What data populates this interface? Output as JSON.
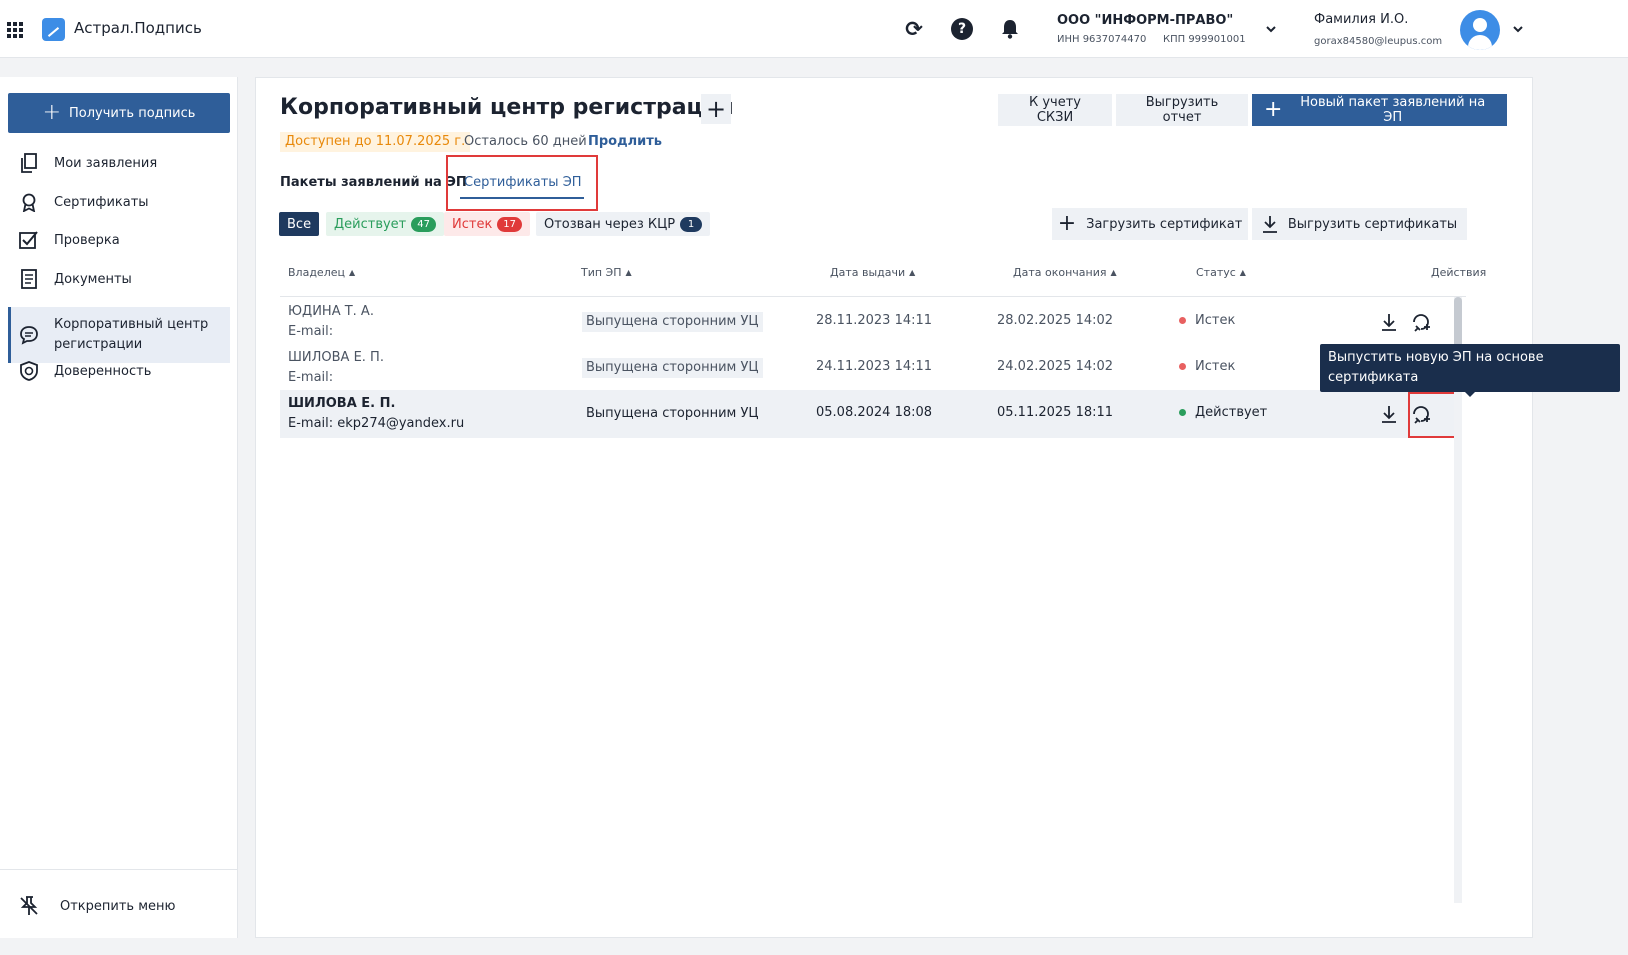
{
  "header": {
    "app_title": "Астрал.Подпись",
    "org_name": "ООО \"ИНФОРМ-ПРАВО\"",
    "org_inn": "ИНН 9637074470",
    "org_kpp": "КПП 999901001",
    "user_name": "Фамилия И.О.",
    "user_email": "gorax84580@leupus.com"
  },
  "sidebar": {
    "get_sign_label": "Получить подпись",
    "items": [
      {
        "label": "Мои заявления"
      },
      {
        "label": "Сертификаты"
      },
      {
        "label": "Проверка"
      },
      {
        "label": "Документы"
      },
      {
        "label": "Корпоративный центр регистрации"
      },
      {
        "label": "Доверенность"
      }
    ],
    "unpin_label": "Открепить меню"
  },
  "main": {
    "title": "Корпоративный центр регистрации",
    "available_until": "Доступен до 11.07.2025 г.",
    "days_left": "Осталось 60 дней",
    "extend": "Продлить",
    "buttons": {
      "skzi": "К учету СКЗИ",
      "report": "Выгрузить отчет",
      "new_package": "Новый пакет заявлений на ЭП"
    },
    "tabs": [
      {
        "label": "Пакеты заявлений на ЭП"
      },
      {
        "label": "Сертификаты ЭП"
      }
    ],
    "filters": {
      "all": "Все",
      "active": "Действует",
      "active_count": "47",
      "expired": "Истек",
      "expired_count": "17",
      "revoked": "Отозван через КЦР",
      "revoked_count": "1"
    },
    "upload_cert": "Загрузить сертификат",
    "download_certs": "Выгрузить сертификаты",
    "columns": {
      "owner": "Владелец",
      "type": "Тип ЭП",
      "issued": "Дата выдачи",
      "expires": "Дата окончания",
      "status": "Статус",
      "actions": "Действия"
    },
    "rows": [
      {
        "owner": "ЮДИНА Т. А.",
        "email": "E-mail:",
        "type": "Выпущена сторонним УЦ",
        "issued": "28.11.2023 14:11",
        "expires": "28.02.2025 14:02",
        "status": "Истек"
      },
      {
        "owner": "ШИЛОВА Е. П.",
        "email": "E-mail:",
        "type": "Выпущена сторонним УЦ",
        "issued": "24.11.2023 14:11",
        "expires": "24.02.2025 14:02",
        "status": "Истек"
      },
      {
        "owner": "ШИЛОВА Е. П.",
        "email": "E-mail: ekp274@yandex.ru",
        "type": "Выпущена сторонним УЦ",
        "issued": "05.08.2024 18:08",
        "expires": "05.11.2025 18:11",
        "status": "Действует"
      }
    ],
    "tooltip": "Выпустить новую ЭП на основе сертификата"
  },
  "colors": {
    "primary": "#2f5e99",
    "active_green": "#2a9d5c",
    "expired_red": "#e03a3a",
    "warning_orange": "#e8890b",
    "highlight_red": "#e03a3a"
  }
}
